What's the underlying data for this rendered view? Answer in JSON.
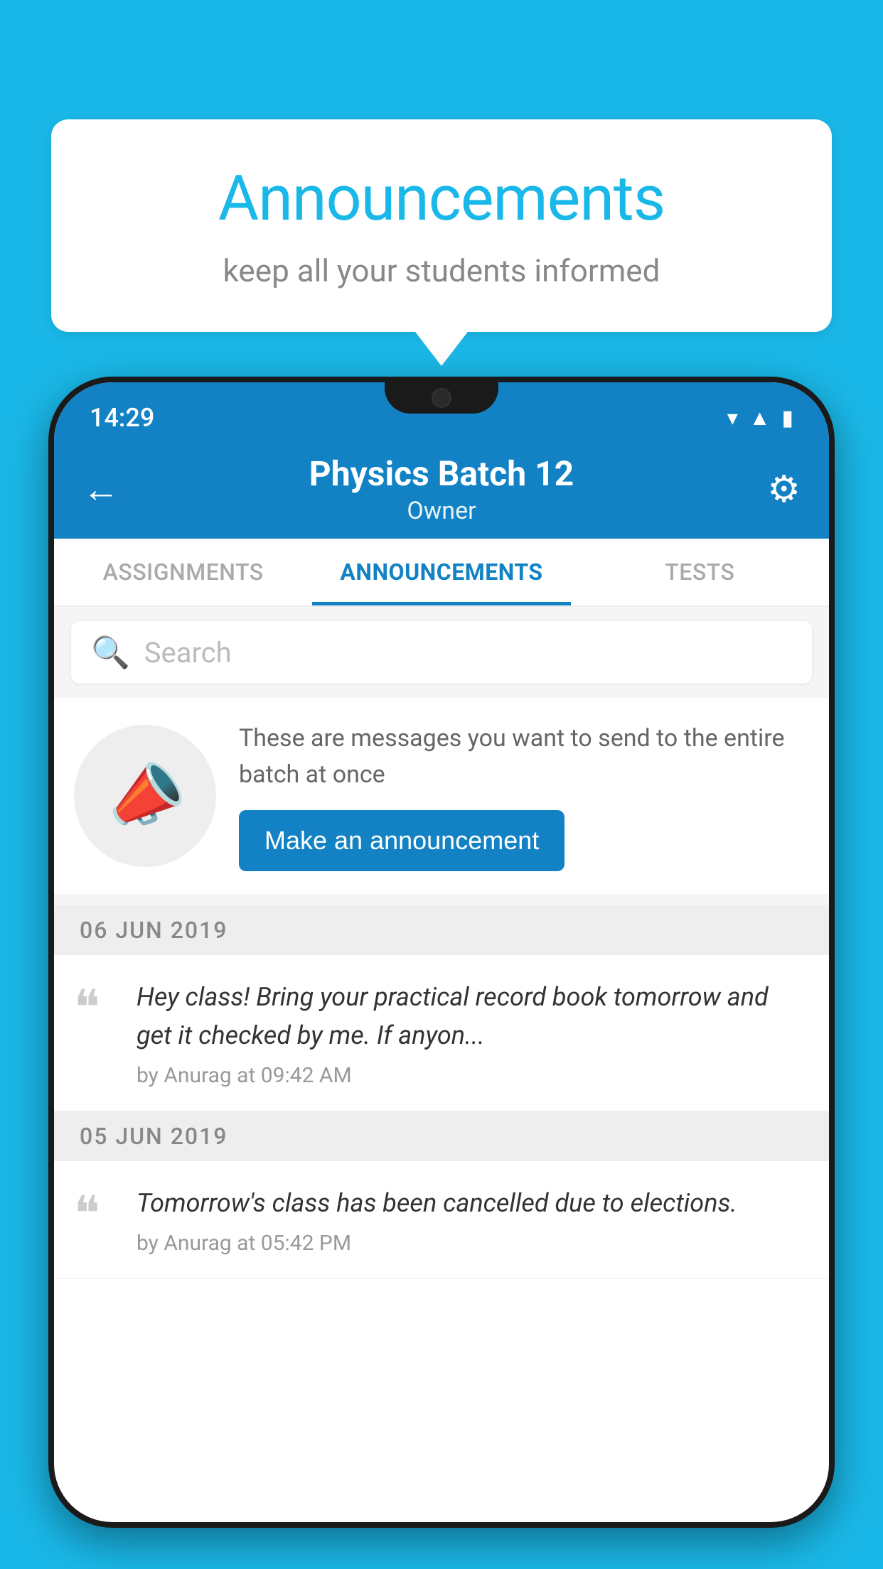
{
  "page": {
    "background_color": "#1ab8e8"
  },
  "announcement_card": {
    "title": "Announcements",
    "subtitle": "keep all your students informed"
  },
  "phone": {
    "status_bar": {
      "time": "14:29",
      "icons": [
        "wifi",
        "signal",
        "battery"
      ]
    },
    "header": {
      "back_label": "←",
      "title": "Physics Batch 12",
      "subtitle": "Owner",
      "gear_label": "⚙"
    },
    "tabs": [
      {
        "label": "ASSIGNMENTS",
        "active": false
      },
      {
        "label": "ANNOUNCEMENTS",
        "active": true
      },
      {
        "label": "TESTS",
        "active": false
      }
    ],
    "search": {
      "placeholder": "Search"
    },
    "make_announcement": {
      "description": "These are messages you want to send to the entire batch at once",
      "button_label": "Make an announcement"
    },
    "announcements": [
      {
        "date": "06  JUN  2019",
        "message": "Hey class! Bring your practical record book tomorrow and get it checked by me. If anyon...",
        "meta": "by Anurag at 09:42 AM"
      },
      {
        "date": "05  JUN  2019",
        "message": "Tomorrow's class has been cancelled due to elections.",
        "meta": "by Anurag at 05:42 PM"
      }
    ]
  }
}
